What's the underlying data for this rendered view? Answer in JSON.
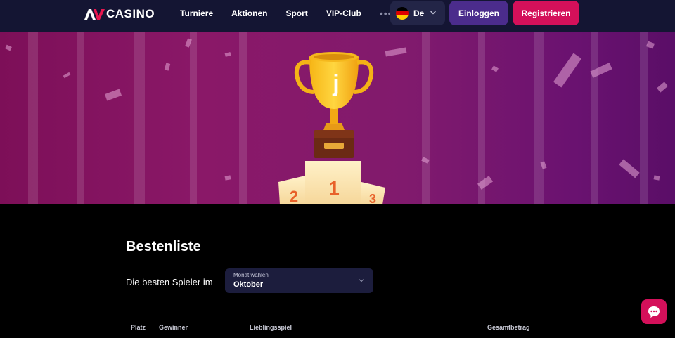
{
  "header": {
    "logo_text": "CASINO",
    "nav": [
      "Turniere",
      "Aktionen",
      "Sport",
      "VIP-Club"
    ],
    "more": "•••",
    "language": "De",
    "login": "Einloggen",
    "register": "Registrieren"
  },
  "banner": {
    "trophy_letter": "j",
    "podium": [
      "2",
      "1",
      "3"
    ]
  },
  "main": {
    "title": "Bestenliste",
    "subtitle": "Die besten Spieler im",
    "month_select": {
      "caption": "Monat wählen",
      "value": "Oktober"
    }
  },
  "table": {
    "headers": [
      "Platz",
      "Gewinner",
      "Lieblingsspiel",
      "Gesamtbetrag"
    ]
  },
  "icons": {
    "logo": "logo-mark-icon",
    "flag": "germany-flag-icon",
    "chevron": "chevron-down-icon",
    "chat": "chat-icon"
  },
  "colors": {
    "header_bg": "#141533",
    "login": "#4b2c8c",
    "register": "#d4105a",
    "banner": "#811a6d"
  }
}
